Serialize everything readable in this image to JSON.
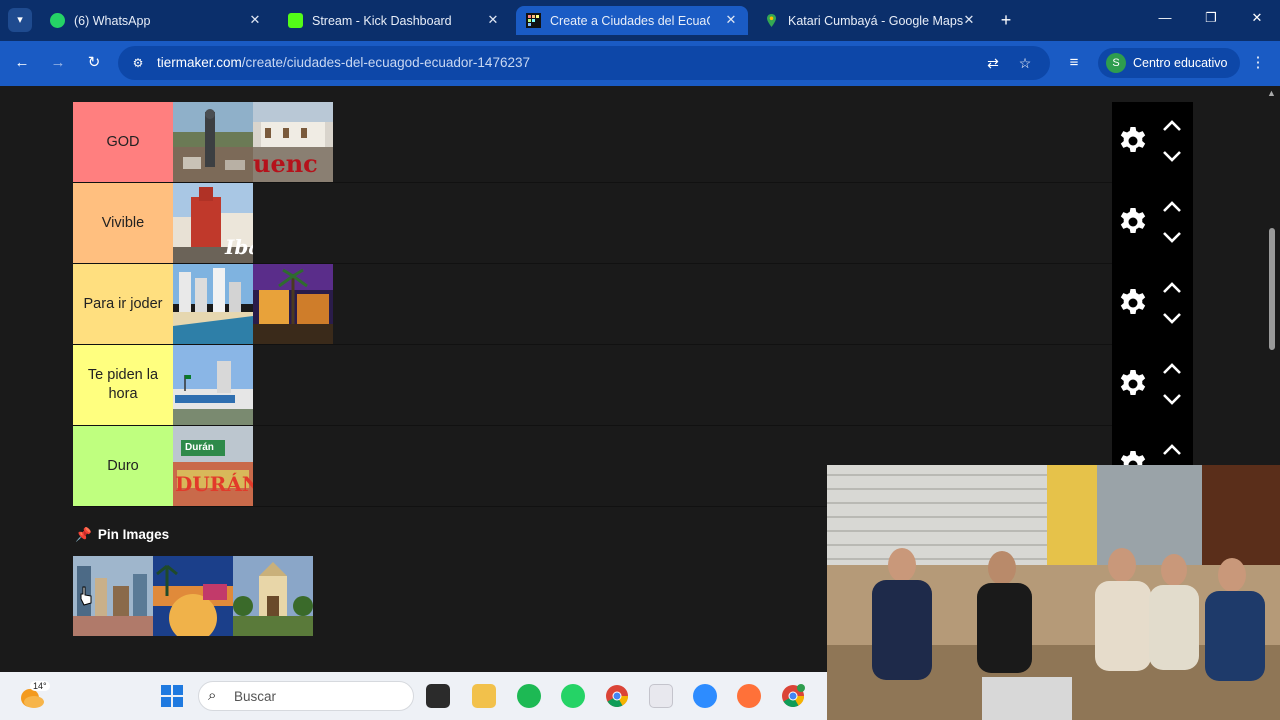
{
  "browser": {
    "tabs": [
      {
        "label": "(6) WhatsApp",
        "icon": "whatsapp-icon",
        "active": false
      },
      {
        "label": "Stream - Kick Dashboard",
        "icon": "kick-icon",
        "active": false
      },
      {
        "label": "Create a Ciudades del EcuaGOD",
        "icon": "tiermaker-icon",
        "active": true
      },
      {
        "label": "Katari Cumbayá - Google Maps",
        "icon": "maps-pin-icon",
        "active": false
      }
    ],
    "url_domain": "tiermaker.com",
    "url_path": "/create/ciudades-del-ecuagod-ecuador-1476237",
    "profile_label": "Centro educativo",
    "profile_initial": "S"
  },
  "tiers": [
    {
      "label": "GOD",
      "color": "#ff7f7f",
      "items": [
        "Quito city view with statue",
        "Cuenca sign"
      ]
    },
    {
      "label": "Vivible",
      "color": "#ffbf7f",
      "items": [
        "Ibarra colonial church"
      ]
    },
    {
      "label": "Para ir joder",
      "color": "#ffdf7f",
      "items": [
        "Beach city coastline",
        "Night palm street"
      ]
    },
    {
      "label": "Te piden la hora",
      "color": "#ffff7f",
      "items": [
        "City monument sign"
      ]
    },
    {
      "label": "Duro",
      "color": "#bfff7f",
      "items": [
        "Durán sign"
      ]
    }
  ],
  "image_overlays": {
    "cuenca": "uenc",
    "ibarra": "Iba",
    "duran_top": "Durán",
    "duran_big": "DURÁN"
  },
  "pin_section": {
    "title": "Pin Images",
    "images": [
      "Guayaquil riverfront",
      "Plaza with palm trees",
      "Colonial plaza"
    ]
  },
  "taskbar": {
    "weather_temp": "14°",
    "search_placeholder": "Buscar"
  }
}
